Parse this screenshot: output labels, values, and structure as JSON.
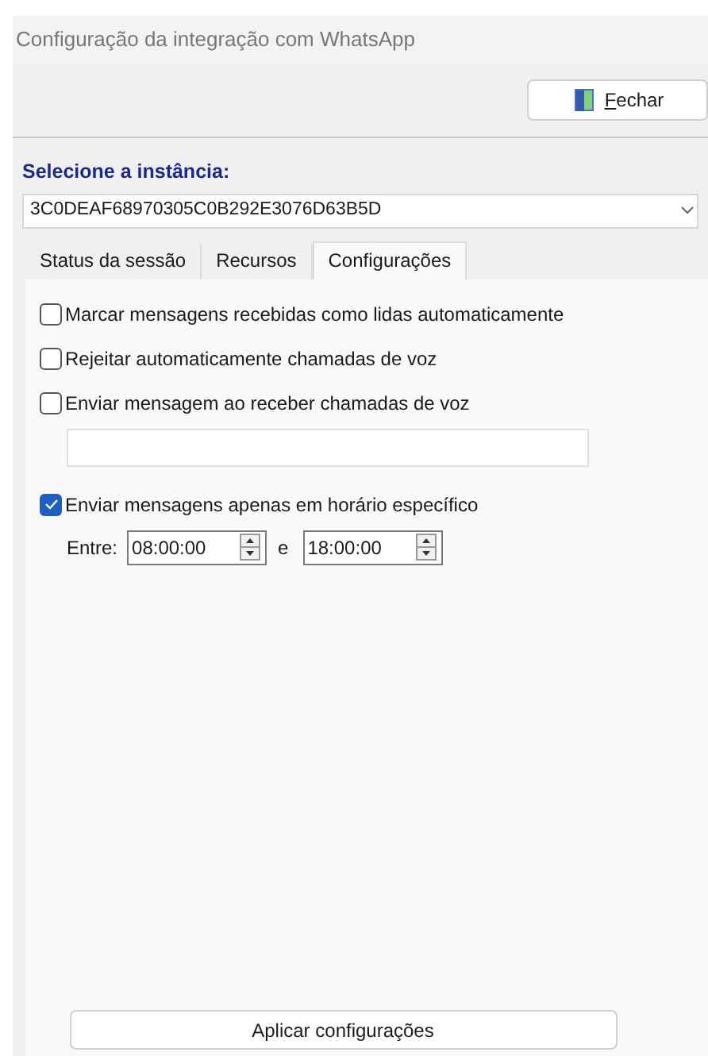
{
  "window": {
    "title": "Configuração da integração com WhatsApp"
  },
  "toolbar": {
    "close_button": {
      "label": "Fechar",
      "mnemonic_underlined": true
    }
  },
  "instance": {
    "label": "Selecione a instância:",
    "value": "3C0DEAF68970305C0B292E3076D63B5D"
  },
  "tabs": [
    {
      "label": "Status da sessão",
      "selected": false
    },
    {
      "label": "Recursos",
      "selected": false
    },
    {
      "label": "Configurações",
      "selected": true
    }
  ],
  "options": [
    {
      "kind": "checkbox",
      "label": "Marcar mensagens recebidas como lidas automaticamente",
      "checked": false
    },
    {
      "kind": "checkbox",
      "label": "Rejeitar automaticamente chamadas de voz",
      "checked": false
    },
    {
      "kind": "checkbox",
      "label": "Enviar mensagem ao receber chamadas de voz",
      "checked": false
    },
    {
      "kind": "textfield"
    },
    {
      "kind": "checkbox",
      "label": "Enviar mensagens apenas em horário específico",
      "checked": true
    },
    {
      "kind": "timerange",
      "label": "Entre:",
      "start": "08:00:00",
      "separator": "e",
      "end": "18:00:00"
    }
  ],
  "apply_button": {
    "label": "Aplicar configurações"
  }
}
